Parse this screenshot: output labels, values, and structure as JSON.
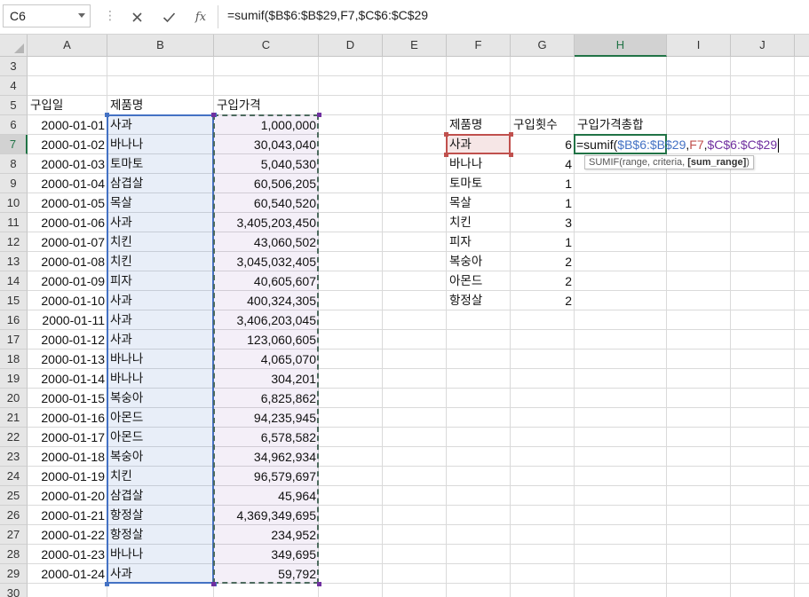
{
  "formula_bar": {
    "name_box": "C6",
    "fx_label": "fx",
    "formula_text": "=sumif($B$6:$B$29,F7,$C$6:$C$29",
    "cancel_icon": "close-icon",
    "enter_icon": "check-icon"
  },
  "columns": [
    "A",
    "B",
    "C",
    "D",
    "E",
    "F",
    "G",
    "H",
    "I",
    "J"
  ],
  "rows": [
    "3",
    "4",
    "5",
    "6",
    "7",
    "8",
    "9",
    "10",
    "11",
    "12",
    "13",
    "14",
    "15",
    "16",
    "17",
    "18",
    "19",
    "20",
    "21",
    "22",
    "23",
    "24",
    "25",
    "26",
    "27",
    "28",
    "29",
    "30"
  ],
  "headers": {
    "date": "구입일",
    "product": "제품명",
    "price": "구입가격"
  },
  "purchases": [
    {
      "date": "2000-01-01",
      "product": "사과",
      "price": "1,000,000"
    },
    {
      "date": "2000-01-02",
      "product": "바나나",
      "price": "30,043,040"
    },
    {
      "date": "2000-01-03",
      "product": "토마토",
      "price": "5,040,530"
    },
    {
      "date": "2000-01-04",
      "product": "삼겹살",
      "price": "60,506,205"
    },
    {
      "date": "2000-01-05",
      "product": "목살",
      "price": "60,540,520"
    },
    {
      "date": "2000-01-06",
      "product": "사과",
      "price": "3,405,203,450"
    },
    {
      "date": "2000-01-07",
      "product": "치킨",
      "price": "43,060,502"
    },
    {
      "date": "2000-01-08",
      "product": "치킨",
      "price": "3,045,032,405"
    },
    {
      "date": "2000-01-09",
      "product": "피자",
      "price": "40,605,607"
    },
    {
      "date": "2000-01-10",
      "product": "사과",
      "price": "400,324,305"
    },
    {
      "date": "2000-01-11",
      "product": "사과",
      "price": "3,406,203,045"
    },
    {
      "date": "2000-01-12",
      "product": "사과",
      "price": "123,060,605"
    },
    {
      "date": "2000-01-13",
      "product": "바나나",
      "price": "4,065,070"
    },
    {
      "date": "2000-01-14",
      "product": "바나나",
      "price": "304,201"
    },
    {
      "date": "2000-01-15",
      "product": "복숭아",
      "price": "6,825,862"
    },
    {
      "date": "2000-01-16",
      "product": "아몬드",
      "price": "94,235,945"
    },
    {
      "date": "2000-01-17",
      "product": "아몬드",
      "price": "6,578,582"
    },
    {
      "date": "2000-01-18",
      "product": "복숭아",
      "price": "34,962,934"
    },
    {
      "date": "2000-01-19",
      "product": "치킨",
      "price": "96,579,697"
    },
    {
      "date": "2000-01-20",
      "product": "삼겹살",
      "price": "45,964"
    },
    {
      "date": "2000-01-21",
      "product": "항정살",
      "price": "4,369,349,695"
    },
    {
      "date": "2000-01-22",
      "product": "항정살",
      "price": "234,952"
    },
    {
      "date": "2000-01-23",
      "product": "바나나",
      "price": "349,695"
    },
    {
      "date": "2000-01-24",
      "product": "사과",
      "price": "59,792"
    }
  ],
  "summary_headers": {
    "product": "제품명",
    "count": "구입횟수",
    "total": "구입가격총합"
  },
  "summary": [
    {
      "product": "사과",
      "count": "6"
    },
    {
      "product": "바나나",
      "count": "4"
    },
    {
      "product": "토마토",
      "count": "1"
    },
    {
      "product": "목살",
      "count": "1"
    },
    {
      "product": "치킨",
      "count": "3"
    },
    {
      "product": "피자",
      "count": "1"
    },
    {
      "product": "복숭아",
      "count": "2"
    },
    {
      "product": "아몬드",
      "count": "2"
    },
    {
      "product": "항정살",
      "count": "2"
    }
  ],
  "editing": {
    "prefix": "=sumif(",
    "range_ref": "$B$6:$B$29",
    "sep1": ",",
    "criteria_ref": "F7",
    "sep2": ",",
    "sum_ref": "$C$6:$C$29"
  },
  "tooltip": {
    "text": "SUMIF(range, criteria, ",
    "bold": "[sum_range]",
    "close": ")"
  },
  "colors": {
    "range_blue": "#4472c4",
    "criteria_red": "#c0504d",
    "sum_purple": "#7030a0",
    "excel_green": "#217346"
  }
}
